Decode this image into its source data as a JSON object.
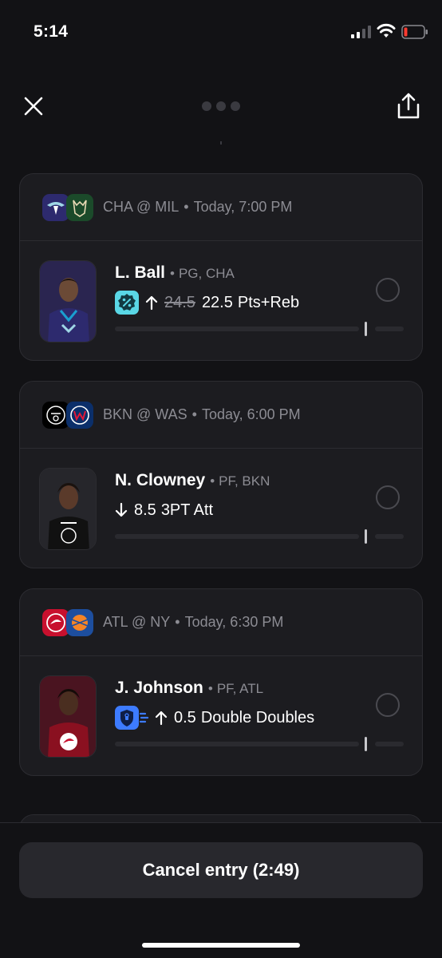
{
  "status_bar": {
    "time": "5:14"
  },
  "entries": [
    {
      "home_team": "CHA",
      "away_team": "MIL",
      "matchup": "CHA @ MIL",
      "game_time": "Today, 7:00 PM",
      "home_color": "#2d2a6e",
      "away_color": "#1b4a2a",
      "player_name": "L. Ball",
      "player_meta": "PG, CHA",
      "badge": "discount-badge-icon",
      "direction": "up",
      "old_line": "24.5",
      "line": "22.5",
      "stat": "Pts+Reb",
      "jersey_color": "#2d2a6e",
      "img_bg": "#2a2550"
    },
    {
      "home_team": "BKN",
      "away_team": "WAS",
      "matchup": "BKN @ WAS",
      "game_time": "Today, 6:00 PM",
      "home_color": "#000000",
      "away_color": "#0b2f6a",
      "player_name": "N. Clowney",
      "player_meta": "PF, BKN",
      "badge": "",
      "direction": "down",
      "old_line": "",
      "line": "8.5",
      "stat": "3PT Att",
      "jersey_color": "#111111",
      "img_bg": "#26262b"
    },
    {
      "home_team": "ATL",
      "away_team": "NY",
      "matchup": "ATL @ NY",
      "game_time": "Today, 6:30 PM",
      "home_color": "#c8102e",
      "away_color": "#1d4e9e",
      "player_name": "J. Johnson",
      "player_meta": "PF, ATL",
      "badge": "shield-boost-badge-icon",
      "direction": "up",
      "old_line": "",
      "line": "0.5",
      "stat": "Double Doubles",
      "jersey_color": "#8a1020",
      "img_bg": "#4a1420"
    }
  ],
  "cancel_button": {
    "label": "Cancel entry (2:49)"
  },
  "colors": {
    "background": "#121215",
    "card": "#1c1c20",
    "accent_teal": "#5ad7e6",
    "accent_blue": "#3d7bff"
  }
}
